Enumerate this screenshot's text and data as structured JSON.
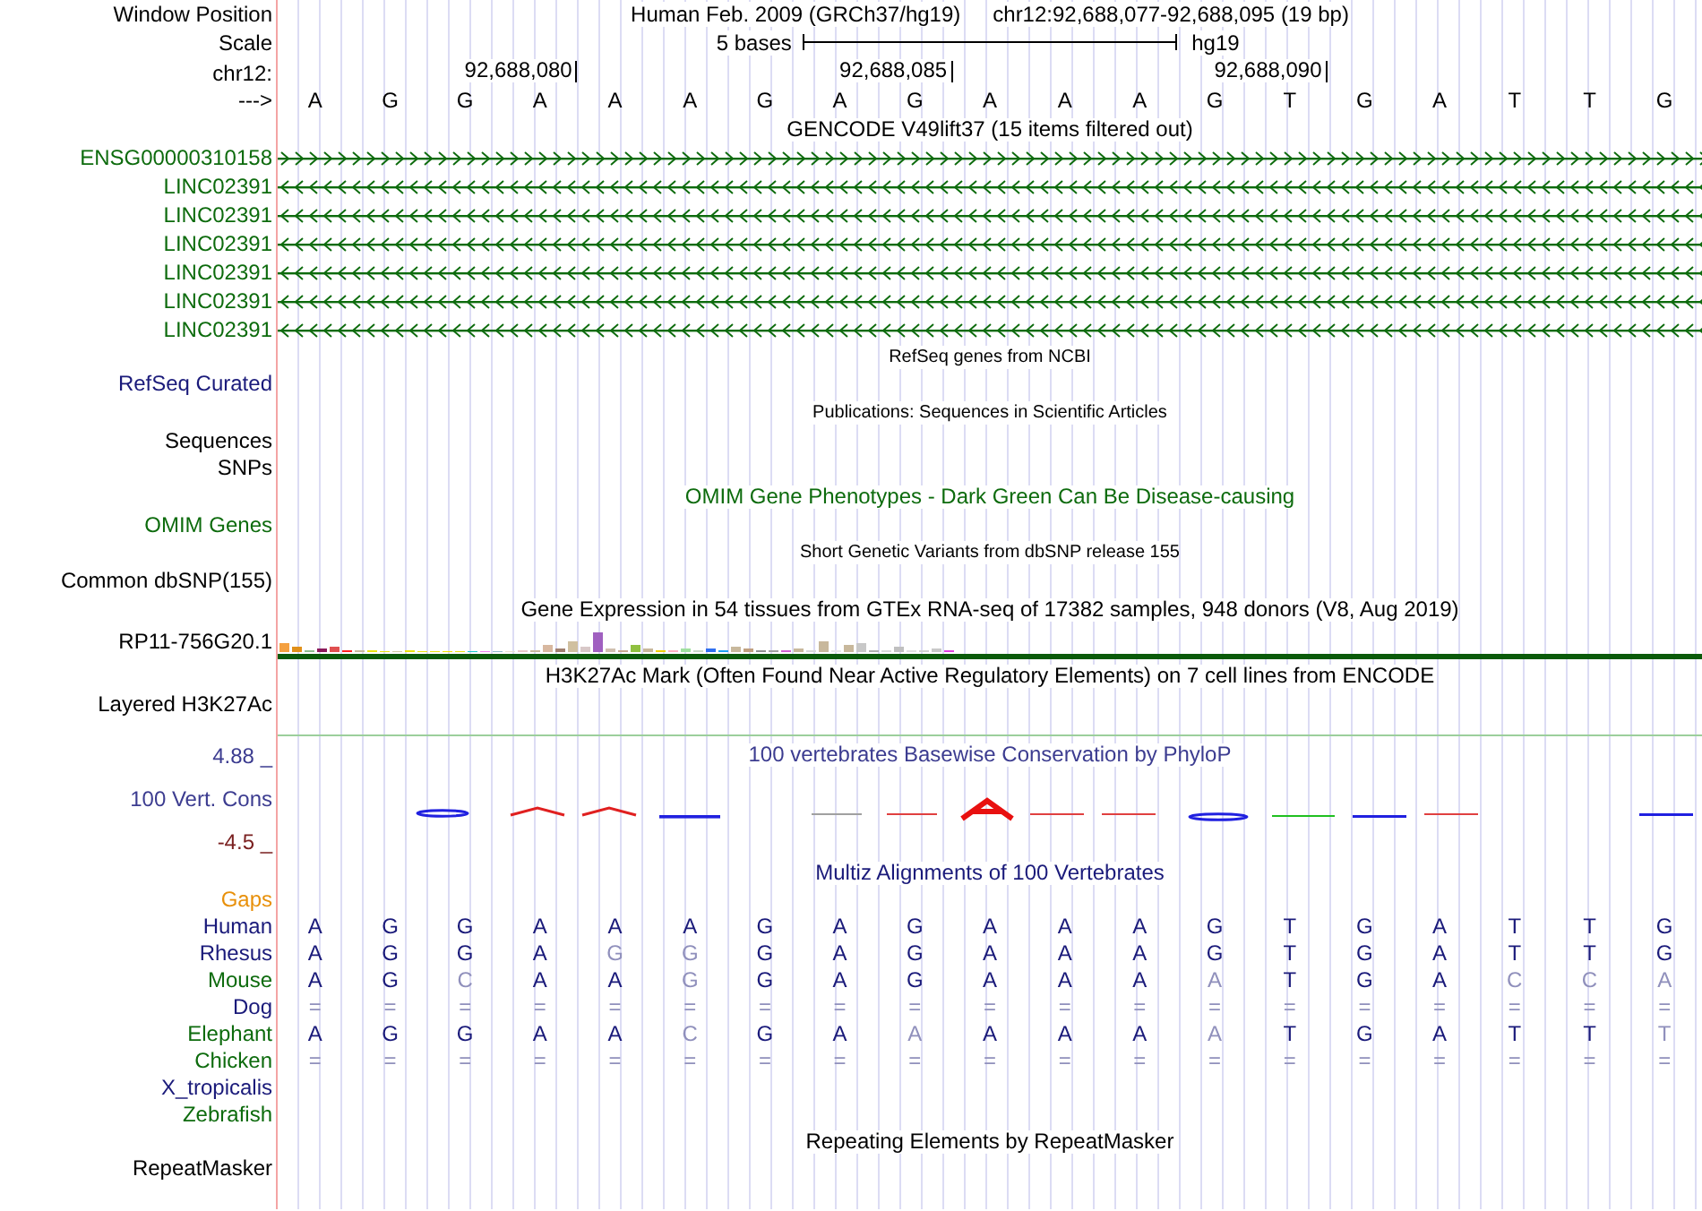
{
  "header": {
    "position_label": "Window Position",
    "assembly_text": "Human Feb. 2009 (GRCh37/hg19)",
    "range_text": "chr12:92,688,077-92,688,095 (19 bp)",
    "scale_label": "Scale",
    "scale_text": "5 bases",
    "scale_assembly": "hg19",
    "chrom_label": "chr12:",
    "ticks": [
      "92,688,080",
      "92,688,085",
      "92,688,090"
    ],
    "strand_label": "--->",
    "bases": [
      "A",
      "G",
      "G",
      "A",
      "A",
      "A",
      "G",
      "A",
      "G",
      "A",
      "A",
      "A",
      "G",
      "T",
      "G",
      "A",
      "T",
      "T",
      "G"
    ]
  },
  "gencode": {
    "title": "GENCODE V49lift37 (15 items filtered out)",
    "genes": [
      {
        "name": "ENSG00000310158",
        "kind": "forward"
      },
      {
        "name": "LINC02391",
        "kind": "reverse"
      },
      {
        "name": "LINC02391",
        "kind": "reverse"
      },
      {
        "name": "LINC02391",
        "kind": "reverse"
      },
      {
        "name": "LINC02391",
        "kind": "reverse"
      },
      {
        "name": "LINC02391",
        "kind": "reverse"
      },
      {
        "name": "LINC02391",
        "kind": "reverse"
      }
    ]
  },
  "refseq": {
    "title": "RefSeq genes from NCBI",
    "label": "RefSeq Curated"
  },
  "publications": {
    "title": "Publications: Sequences in Scientific Articles",
    "labels": [
      "Sequences",
      "SNPs"
    ]
  },
  "omim": {
    "title": "OMIM Gene Phenotypes - Dark Green Can Be Disease-causing",
    "label": "OMIM Genes"
  },
  "dbsnp": {
    "title": "Short Genetic Variants from dbSNP release 155",
    "label": "Common dbSNP(155)"
  },
  "gtex": {
    "title": "Gene Expression in 54 tissues from GTEx RNA-seq of 17382 samples, 948 donors (V8, Aug 2019)",
    "label": "RP11-756G20.1"
  },
  "h3k27ac": {
    "title": "H3K27Ac Mark (Often Found Near Active Regulatory Elements) on 7 cell lines from ENCODE",
    "label": "Layered H3K27Ac"
  },
  "phylop": {
    "title": "100 vertebrates Basewise Conservation by PhyloP",
    "label": "100 Vert. Cons",
    "max_label": "4.88 _",
    "min_label": "-4.5 _"
  },
  "multiz": {
    "title": "Multiz Alignments of 100 Vertebrates",
    "gaps_label": "Gaps",
    "species": [
      {
        "name": "Human",
        "color": "#1a1a7a",
        "cells": [
          {
            "base": "A",
            "faded": false
          },
          {
            "base": "G",
            "faded": false
          },
          {
            "base": "G",
            "faded": false
          },
          {
            "base": "A",
            "faded": false
          },
          {
            "base": "A",
            "faded": false
          },
          {
            "base": "A",
            "faded": false
          },
          {
            "base": "G",
            "faded": false
          },
          {
            "base": "A",
            "faded": false
          },
          {
            "base": "G",
            "faded": false
          },
          {
            "base": "A",
            "faded": false
          },
          {
            "base": "A",
            "faded": false
          },
          {
            "base": "A",
            "faded": false
          },
          {
            "base": "G",
            "faded": false
          },
          {
            "base": "T",
            "faded": false
          },
          {
            "base": "G",
            "faded": false
          },
          {
            "base": "A",
            "faded": false
          },
          {
            "base": "T",
            "faded": false
          },
          {
            "base": "T",
            "faded": false
          },
          {
            "base": "G",
            "faded": false
          }
        ]
      },
      {
        "name": "Rhesus",
        "color": "#1a1a7a",
        "cells": [
          {
            "base": "A",
            "faded": false
          },
          {
            "base": "G",
            "faded": false
          },
          {
            "base": "G",
            "faded": false
          },
          {
            "base": "A",
            "faded": false
          },
          {
            "base": "G",
            "faded": true
          },
          {
            "base": "G",
            "faded": true
          },
          {
            "base": "G",
            "faded": false
          },
          {
            "base": "A",
            "faded": false
          },
          {
            "base": "G",
            "faded": false
          },
          {
            "base": "A",
            "faded": false
          },
          {
            "base": "A",
            "faded": false
          },
          {
            "base": "A",
            "faded": false
          },
          {
            "base": "G",
            "faded": false
          },
          {
            "base": "T",
            "faded": false
          },
          {
            "base": "G",
            "faded": false
          },
          {
            "base": "A",
            "faded": false
          },
          {
            "base": "T",
            "faded": false
          },
          {
            "base": "T",
            "faded": false
          },
          {
            "base": "G",
            "faded": false
          }
        ]
      },
      {
        "name": "Mouse",
        "color": "#0d6b0d",
        "cells": [
          {
            "base": "A",
            "faded": false
          },
          {
            "base": "G",
            "faded": false
          },
          {
            "base": "C",
            "faded": true
          },
          {
            "base": "A",
            "faded": false
          },
          {
            "base": "A",
            "faded": false
          },
          {
            "base": "G",
            "faded": true
          },
          {
            "base": "G",
            "faded": false
          },
          {
            "base": "A",
            "faded": false
          },
          {
            "base": "G",
            "faded": false
          },
          {
            "base": "A",
            "faded": false
          },
          {
            "base": "A",
            "faded": false
          },
          {
            "base": "A",
            "faded": false
          },
          {
            "base": "A",
            "faded": true
          },
          {
            "base": "T",
            "faded": false
          },
          {
            "base": "G",
            "faded": false
          },
          {
            "base": "A",
            "faded": false
          },
          {
            "base": "C",
            "faded": true
          },
          {
            "base": "C",
            "faded": true
          },
          {
            "base": "A",
            "faded": true
          }
        ]
      },
      {
        "name": "Dog",
        "color": "#1a1a7a",
        "cells": [
          {
            "base": "=",
            "faded": true
          },
          {
            "base": "=",
            "faded": true
          },
          {
            "base": "=",
            "faded": true
          },
          {
            "base": "=",
            "faded": true
          },
          {
            "base": "=",
            "faded": true
          },
          {
            "base": "=",
            "faded": true
          },
          {
            "base": "=",
            "faded": true
          },
          {
            "base": "=",
            "faded": true
          },
          {
            "base": "=",
            "faded": true
          },
          {
            "base": "=",
            "faded": true
          },
          {
            "base": "=",
            "faded": true
          },
          {
            "base": "=",
            "faded": true
          },
          {
            "base": "=",
            "faded": true
          },
          {
            "base": "=",
            "faded": true
          },
          {
            "base": "=",
            "faded": true
          },
          {
            "base": "=",
            "faded": true
          },
          {
            "base": "=",
            "faded": true
          },
          {
            "base": "=",
            "faded": true
          },
          {
            "base": "=",
            "faded": true
          }
        ]
      },
      {
        "name": "Elephant",
        "color": "#0d6b0d",
        "cells": [
          {
            "base": "A",
            "faded": false
          },
          {
            "base": "G",
            "faded": false
          },
          {
            "base": "G",
            "faded": false
          },
          {
            "base": "A",
            "faded": false
          },
          {
            "base": "A",
            "faded": false
          },
          {
            "base": "C",
            "faded": true
          },
          {
            "base": "G",
            "faded": false
          },
          {
            "base": "A",
            "faded": false
          },
          {
            "base": "A",
            "faded": true
          },
          {
            "base": "A",
            "faded": false
          },
          {
            "base": "A",
            "faded": false
          },
          {
            "base": "A",
            "faded": false
          },
          {
            "base": "A",
            "faded": true
          },
          {
            "base": "T",
            "faded": false
          },
          {
            "base": "G",
            "faded": false
          },
          {
            "base": "A",
            "faded": false
          },
          {
            "base": "T",
            "faded": false
          },
          {
            "base": "T",
            "faded": false
          },
          {
            "base": "T",
            "faded": true
          }
        ]
      },
      {
        "name": "Chicken",
        "color": "#0d6b0d",
        "cells": [
          {
            "base": "=",
            "faded": true
          },
          {
            "base": "=",
            "faded": true
          },
          {
            "base": "=",
            "faded": true
          },
          {
            "base": "=",
            "faded": true
          },
          {
            "base": "=",
            "faded": true
          },
          {
            "base": "=",
            "faded": true
          },
          {
            "base": "=",
            "faded": true
          },
          {
            "base": "=",
            "faded": true
          },
          {
            "base": "=",
            "faded": true
          },
          {
            "base": "=",
            "faded": true
          },
          {
            "base": "=",
            "faded": true
          },
          {
            "base": "=",
            "faded": true
          },
          {
            "base": "=",
            "faded": true
          },
          {
            "base": "=",
            "faded": true
          },
          {
            "base": "=",
            "faded": true
          },
          {
            "base": "=",
            "faded": true
          },
          {
            "base": "=",
            "faded": true
          },
          {
            "base": "=",
            "faded": true
          },
          {
            "base": "=",
            "faded": true
          }
        ]
      },
      {
        "name": "X_tropicalis",
        "color": "#1a1a7a"
      },
      {
        "name": "Zebrafish",
        "color": "#0d6b0d"
      }
    ]
  },
  "repeatmasker": {
    "title": "Repeating Elements by RepeatMasker",
    "label": "RepeatMasker"
  }
}
